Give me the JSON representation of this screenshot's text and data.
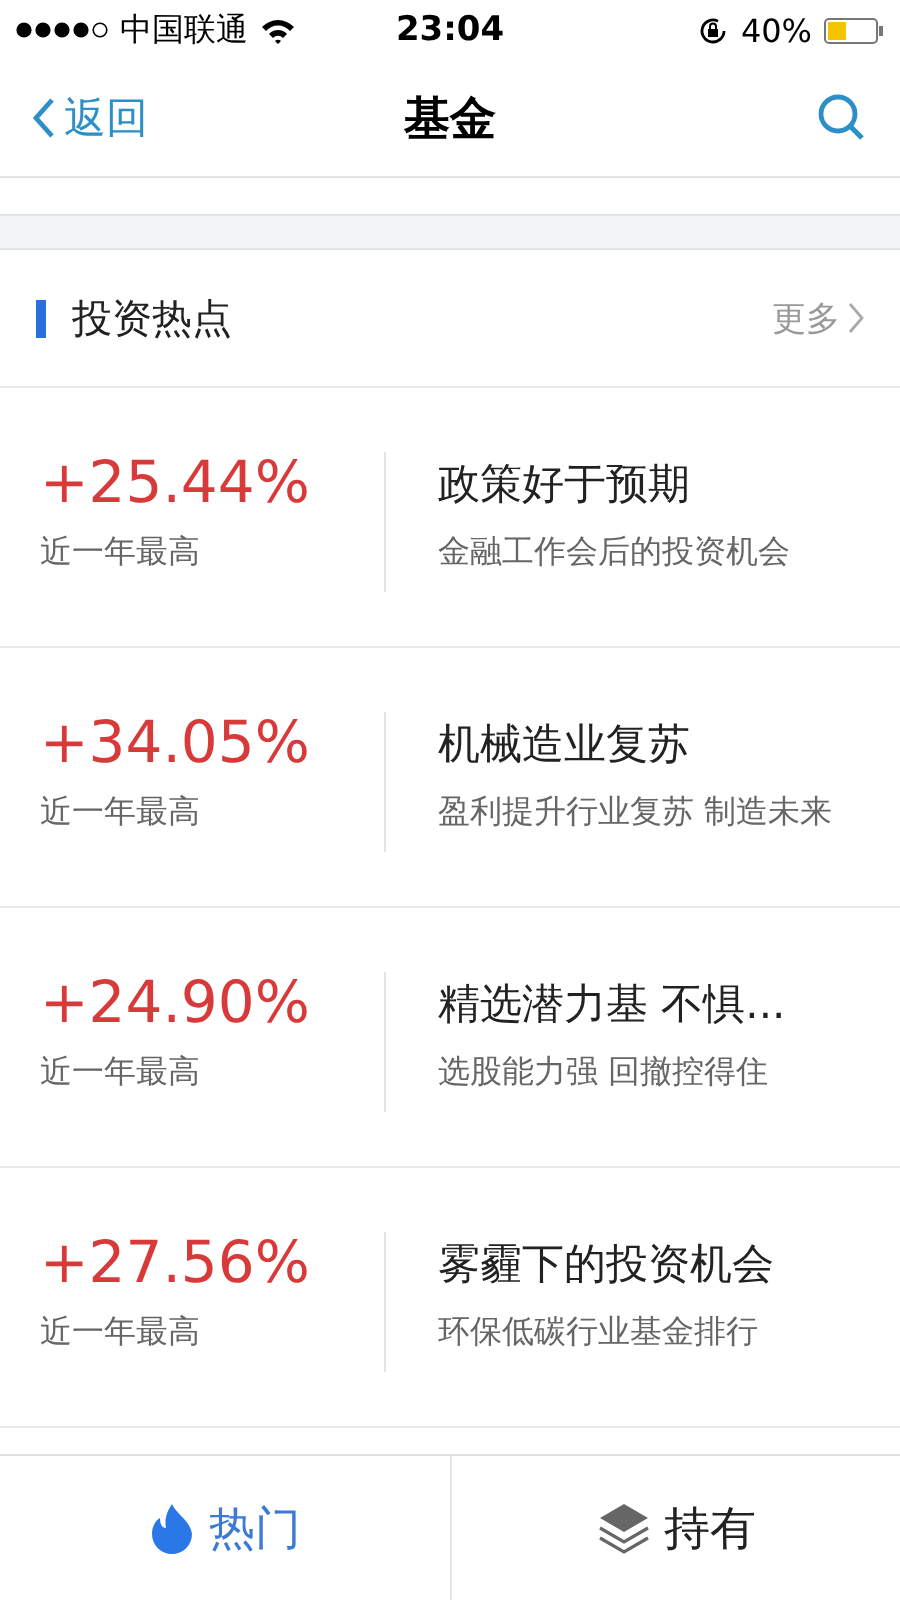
{
  "status_bar": {
    "carrier": "中国联通",
    "time": "23:04",
    "battery": "40%"
  },
  "nav": {
    "back": "返回",
    "title": "基金"
  },
  "section": {
    "title": "投资热点",
    "more": "更多"
  },
  "items": [
    {
      "change": "+25.44%",
      "note": "近一年最高",
      "title": "政策好于预期",
      "desc": "金融工作会后的投资机会"
    },
    {
      "change": "+34.05%",
      "note": "近一年最高",
      "title": "机械造业复苏",
      "desc": "盈利提升行业复苏 制造未来"
    },
    {
      "change": "+24.90%",
      "note": "近一年最高",
      "title": "精选潜力基 不惧...",
      "desc": "选股能力强 回撤控得住"
    },
    {
      "change": "+27.56%",
      "note": "近一年最高",
      "title": "雾霾下的投资机会",
      "desc": "环保低碳行业基金排行"
    }
  ],
  "tabs": [
    {
      "label": "热门",
      "kind": "hot",
      "selected": true
    },
    {
      "label": "持有",
      "kind": "holdings",
      "selected": false
    }
  ]
}
